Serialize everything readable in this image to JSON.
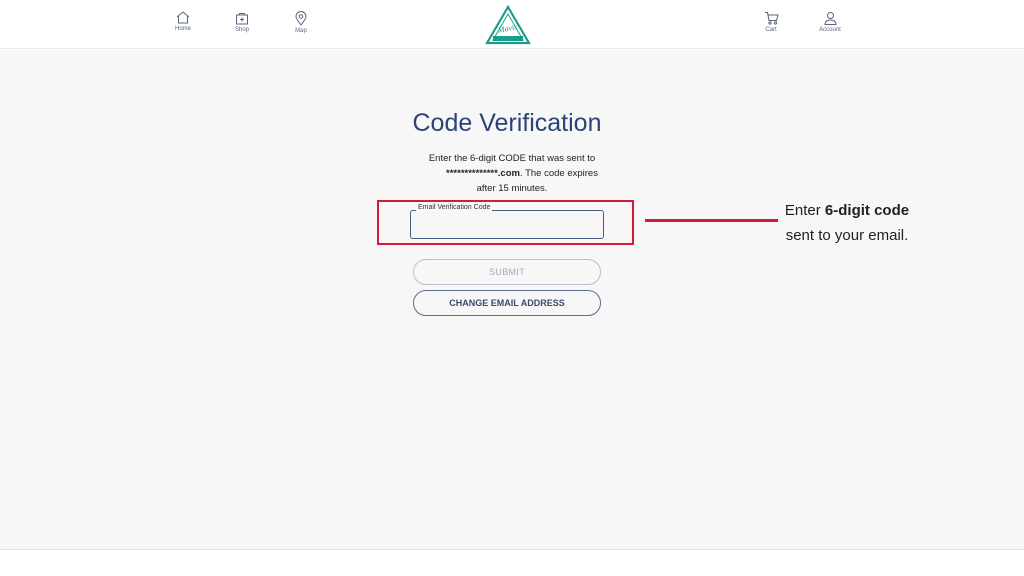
{
  "nav": {
    "left": [
      {
        "label": "Home",
        "icon": "home-icon"
      },
      {
        "label": "Shop",
        "icon": "shop-icon"
      },
      {
        "label": "Map",
        "icon": "map-pin-icon"
      }
    ],
    "right": [
      {
        "label": "Cart",
        "icon": "cart-icon"
      },
      {
        "label": "Account",
        "icon": "account-icon"
      }
    ],
    "logo_text": "Mavis"
  },
  "page": {
    "title": "Code Verification",
    "desc_line1": "Enter the 6-digit CODE that was sent to",
    "desc_masked_email": "**************.com",
    "desc_line2_rest": ". The code expires",
    "desc_line3": "after 15 minutes."
  },
  "form": {
    "code_label": "Email Verification Code",
    "code_value": "",
    "submit_label": "SUBMIT",
    "change_email_label": "CHANGE EMAIL ADDRESS"
  },
  "annotation": {
    "line1_prefix": "Enter ",
    "line1_bold": "6-digit code",
    "line2": "sent to your email."
  },
  "colors": {
    "brand": "#2d4377",
    "accent": "#1a9e8c",
    "highlight": "#d6193a"
  }
}
